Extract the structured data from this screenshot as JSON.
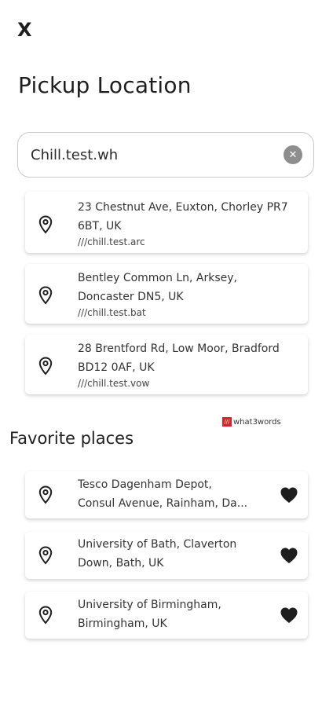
{
  "close_label": "X",
  "title": "Pickup Location",
  "search": {
    "value": "Chill.test.wh"
  },
  "results": [
    {
      "line1": "23 Chestnut Ave, Euxton, Chorley PR7",
      "line2": "6BT, UK",
      "w3w": "///chill.test.arc"
    },
    {
      "line1": "Bentley Common Ln, Arksey,",
      "line2": "Doncaster DN5, UK",
      "w3w": "///chill.test.bat"
    },
    {
      "line1": "28 Brentford Rd, Low Moor, Bradford",
      "line2": "BD12 0AF, UK",
      "w3w": "///chill.test.vow"
    }
  ],
  "w3w_brand": {
    "mark": "///",
    "label": "what3words"
  },
  "favorites_title": "Favorite places",
  "favorites": [
    {
      "line1": "Tesco Dagenham Depot,",
      "line2": "Consul Avenue, Rainham, Da..."
    },
    {
      "line1": "University of Bath, Claverton",
      "line2": "Down, Bath, UK"
    },
    {
      "line1": "University of Birmingham,",
      "line2": "Birmingham, UK"
    }
  ],
  "colors": {
    "accent_red": "#e11f26",
    "text": "#1e1e1e"
  }
}
